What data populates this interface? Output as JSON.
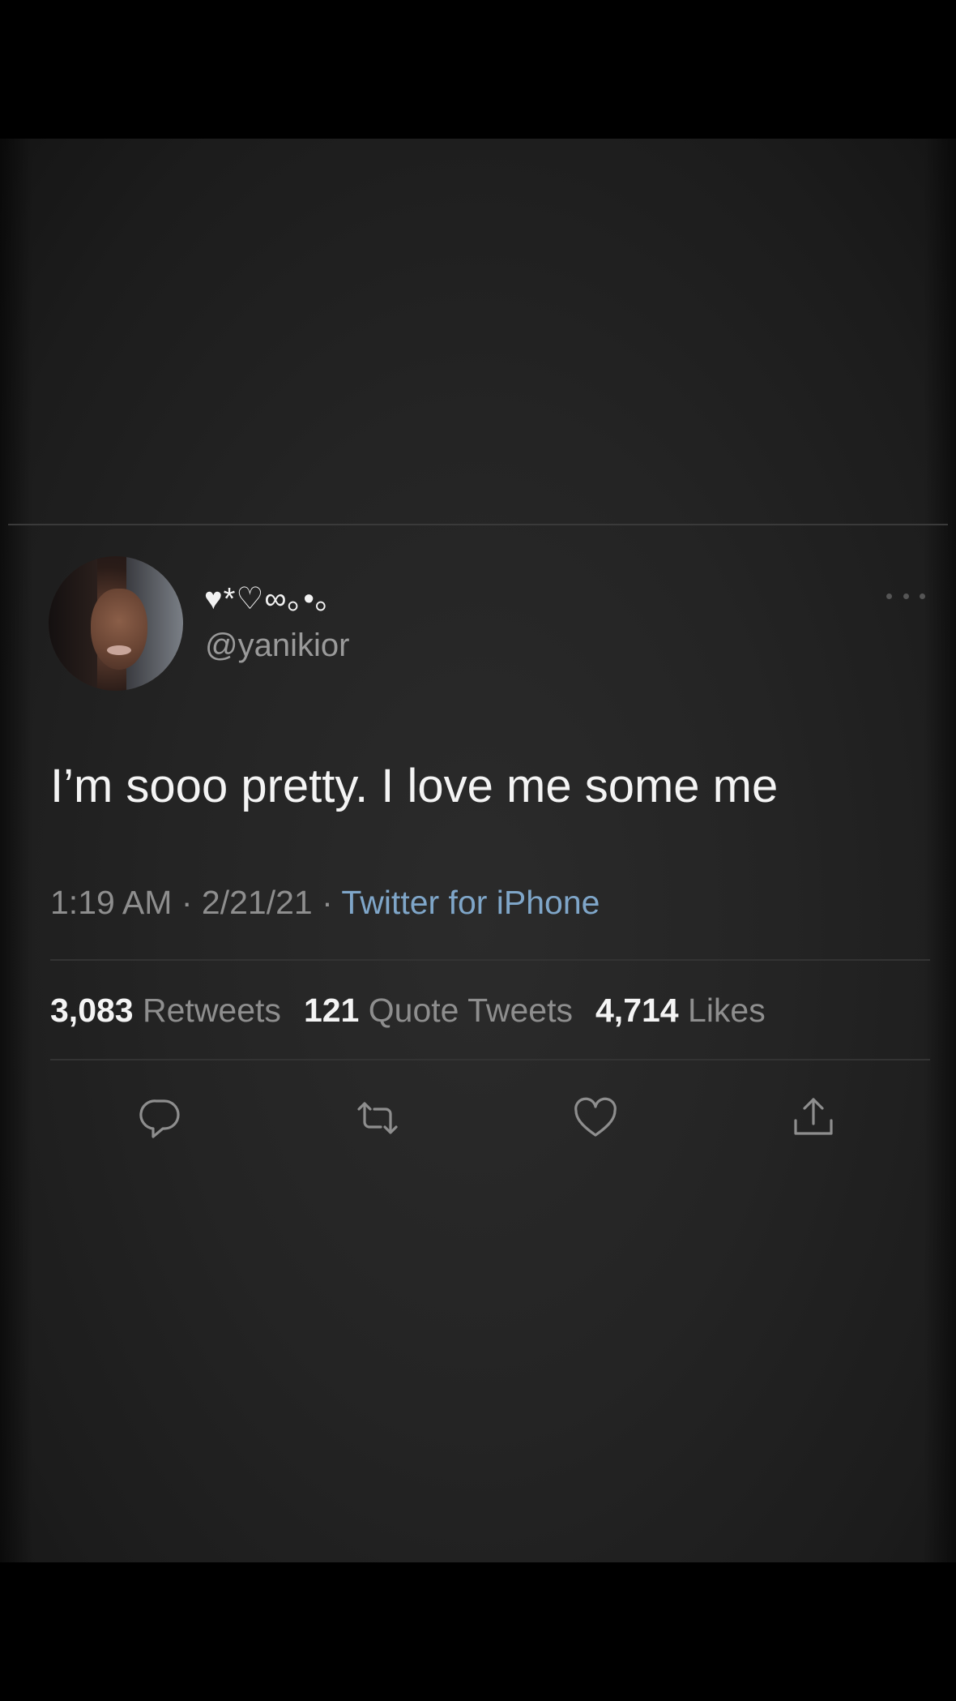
{
  "tweet": {
    "display_name": "♥*♡∞｡•｡",
    "handle": "@yanikior",
    "text": "I’m sooo pretty. I love me some me",
    "time": "1:19 AM",
    "date": "2/21/21",
    "separator": "·",
    "source": "Twitter for iPhone",
    "stats": {
      "retweets_count": "3,083",
      "retweets_label": "Retweets",
      "quotes_count": "121",
      "quotes_label": "Quote Tweets",
      "likes_count": "4,714",
      "likes_label": "Likes"
    }
  },
  "icons": {
    "more": "more-horizontal-icon",
    "reply": "reply-icon",
    "retweet": "retweet-icon",
    "like": "heart-icon",
    "share": "share-icon"
  },
  "colors": {
    "background": "#242424",
    "text_primary": "#f4f4f4",
    "text_secondary": "#8e8e8e",
    "source_link": "#7fa6c9",
    "divider": "#333333"
  }
}
